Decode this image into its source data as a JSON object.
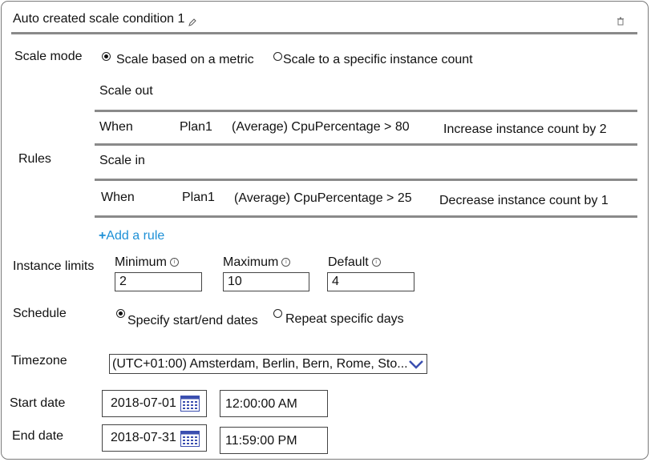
{
  "header": {
    "title": "Auto created scale condition 1",
    "edit_icon": "pencil-icon",
    "delete_icon": "trash-icon"
  },
  "scale_mode": {
    "label": "Scale mode",
    "options": [
      {
        "label": "Scale based on a metric",
        "selected": true
      },
      {
        "label": "Scale to a specific instance count",
        "selected": false
      }
    ]
  },
  "rules": {
    "label": "Rules",
    "scale_out": {
      "heading": "Scale out",
      "when": "When",
      "resource": "Plan1",
      "condition": "(Average) CpuPercentage > 80",
      "action": "Increase instance count by 2"
    },
    "scale_in": {
      "heading": "Scale in",
      "when": "When",
      "resource": "Plan1",
      "condition": "(Average) CpuPercentage > 25",
      "action": "Decrease instance count by 1"
    },
    "add_rule": "Add a rule"
  },
  "instance_limits": {
    "label": "Instance limits",
    "minimum": {
      "label": "Minimum",
      "value": "2"
    },
    "maximum": {
      "label": "Maximum",
      "value": "10"
    },
    "default": {
      "label": "Default",
      "value": "4"
    }
  },
  "schedule": {
    "label": "Schedule",
    "options": [
      {
        "label": "Specify start/end dates",
        "selected": true
      },
      {
        "label": "Repeat specific days",
        "selected": false
      }
    ]
  },
  "timezone": {
    "label": "Timezone",
    "value": "(UTC+01:00) Amsterdam, Berlin, Bern, Rome, Sto..."
  },
  "start_date": {
    "label": "Start date",
    "date": "2018-07-01",
    "time": "12:00:00 AM"
  },
  "end_date": {
    "label": "End date",
    "date": "2018-07-31",
    "time": "11:59:00 PM"
  },
  "colors": {
    "accent": "#1e90d6",
    "divider": "#8a8a8a",
    "calendar": "#3b4fb0",
    "chevron": "#3b4fb0"
  }
}
